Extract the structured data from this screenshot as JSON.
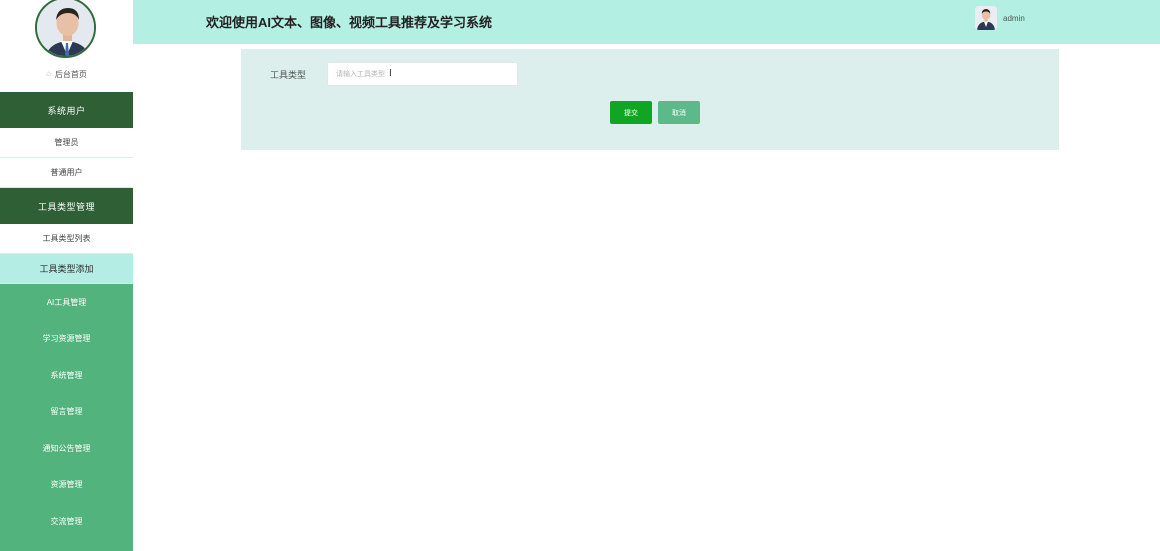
{
  "header": {
    "title": "欢迎使用AI文本、图像、视频工具推荐及学习系统",
    "username": "admin"
  },
  "sidebar": {
    "home": "后台首页",
    "groups": [
      {
        "label": "系统用户",
        "children": [
          "管理员",
          "普通用户"
        ]
      },
      {
        "label": "工具类型管理",
        "children": [
          "工具类型列表",
          "工具类型添加"
        ]
      }
    ],
    "items": [
      "AI工具管理",
      "学习资源管理",
      "系统管理",
      "留言管理",
      "通知公告管理",
      "资源管理",
      "交流管理"
    ]
  },
  "form": {
    "label": "工具类型",
    "placeholder": "请输入工具类型",
    "value": "",
    "submit": "提交",
    "cancel": "取消"
  },
  "colors": {
    "sidebar": "#52b37c",
    "sidebar_group": "#2f5f34",
    "header": "#b3efe3",
    "active_item": "#b3ede3",
    "form_bg": "#dcefec",
    "submit": "#10a624",
    "cancel": "#5cb98a"
  }
}
